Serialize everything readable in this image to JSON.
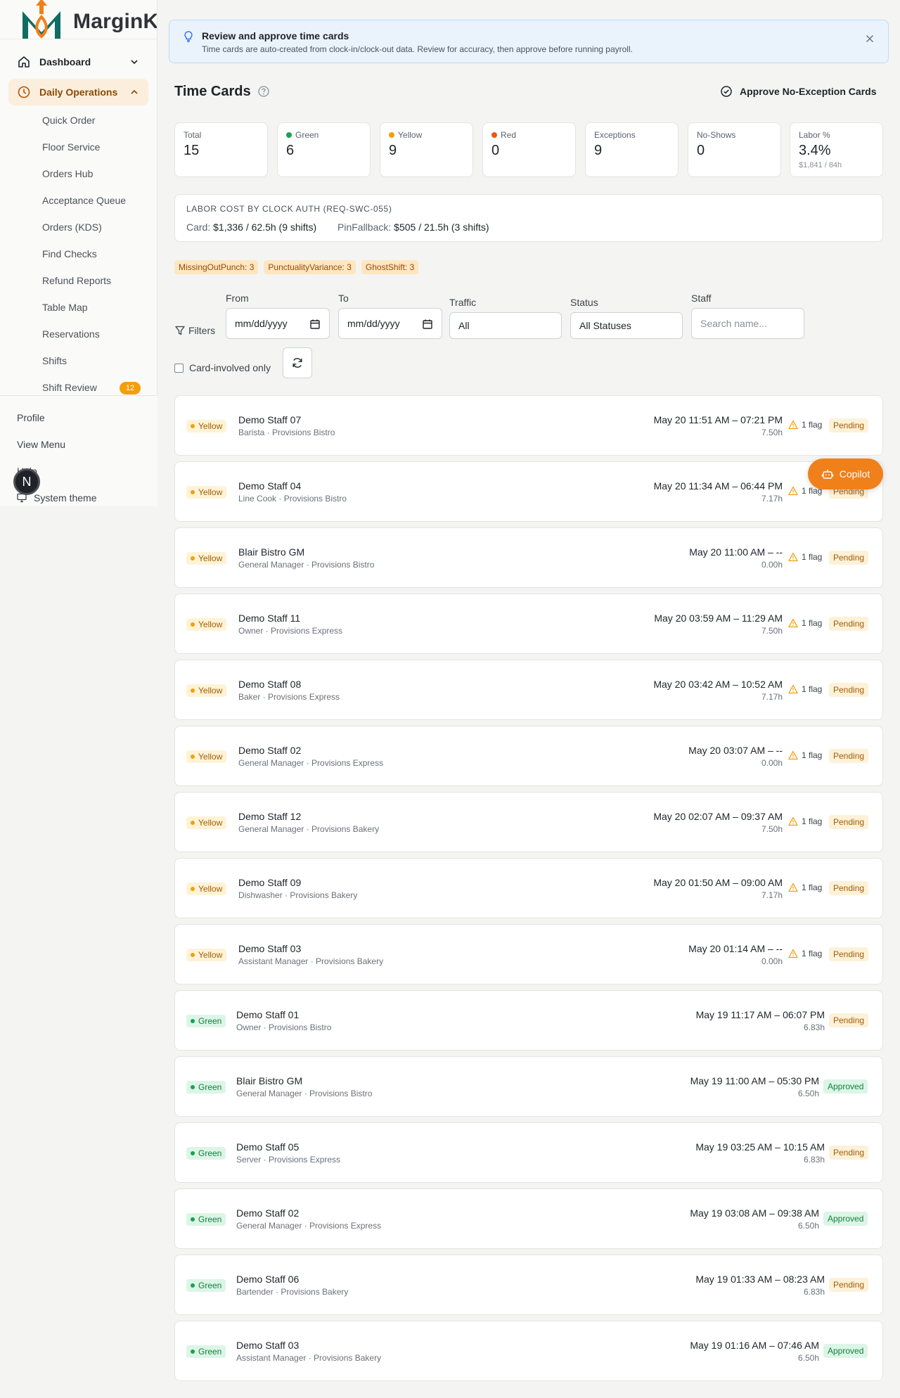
{
  "brand": {
    "name": "MarginK"
  },
  "sidebar": {
    "dashboard": "Dashboard",
    "daily_operations": "Daily Operations",
    "items": [
      "Quick Order",
      "Floor Service",
      "Orders Hub",
      "Acceptance Queue",
      "Orders (KDS)",
      "Find Checks",
      "Refund Reports",
      "Table Map",
      "Reservations",
      "Shifts",
      "Shift Review"
    ],
    "shift_review_count": "12",
    "footer": {
      "profile": "Profile",
      "view_menu": "View Menu",
      "help": "Help",
      "theme": "System theme"
    },
    "avatar_initial": "N"
  },
  "banner": {
    "title": "Review and approve time cards",
    "description": "Time cards are auto-created from clock-in/clock-out data. Review for accuracy, then approve before running payroll."
  },
  "page": {
    "title": "Time Cards",
    "approve_button": "Approve No-Exception Cards"
  },
  "stats": [
    {
      "label": "Total",
      "value": "15",
      "dot": ""
    },
    {
      "label": "Green",
      "value": "6",
      "dot": "#16a34a"
    },
    {
      "label": "Yellow",
      "value": "9",
      "dot": "#f59e0b"
    },
    {
      "label": "Red",
      "value": "0",
      "dot": "#ea580c"
    },
    {
      "label": "Exceptions",
      "value": "9",
      "dot": ""
    },
    {
      "label": "No-Shows",
      "value": "0",
      "dot": ""
    },
    {
      "label": "Labor %",
      "value": "3.4%",
      "dot": "",
      "sub": "$1,841 / 84h"
    }
  ],
  "labor": {
    "title": "LABOR COST BY CLOCK AUTH (REQ-SWC-055)",
    "card_label": "Card:",
    "card_value": "$1,336 / 62.5h (9 shifts)",
    "pin_label": "PinFallback:",
    "pin_value": "$505 / 21.5h (3 shifts)"
  },
  "chips": [
    "MissingOutPunch: 3",
    "PunctualityVariance: 3",
    "GhostShift: 3"
  ],
  "filters": {
    "toggle": "Filters",
    "from_label": "From",
    "from_value": "mm/dd/yyyy",
    "to_label": "To",
    "to_value": "mm/dd/yyyy",
    "traffic_label": "Traffic",
    "traffic_value": "All",
    "status_label": "Status",
    "status_value": "All Statuses",
    "staff_label": "Staff",
    "staff_placeholder": "Search name...",
    "card_only": "Card-involved only"
  },
  "cards": [
    {
      "traffic": "Yellow",
      "name": "Demo Staff 07",
      "role": "Barista · Provisions Bistro",
      "time": "May 20 11:51 AM – 07:21 PM",
      "hours": "7.50h",
      "flag": "1 flag",
      "status": "Pending"
    },
    {
      "traffic": "Yellow",
      "name": "Demo Staff 04",
      "role": "Line Cook · Provisions Bistro",
      "time": "May 20 11:34 AM – 06:44 PM",
      "hours": "7.17h",
      "flag": "1 flag",
      "status": "Pending"
    },
    {
      "traffic": "Yellow",
      "name": "Blair Bistro GM",
      "role": "General Manager · Provisions Bistro",
      "time": "May 20 11:00 AM – --",
      "hours": "0.00h",
      "flag": "1 flag",
      "status": "Pending"
    },
    {
      "traffic": "Yellow",
      "name": "Demo Staff 11",
      "role": "Owner · Provisions Express",
      "time": "May 20 03:59 AM – 11:29 AM",
      "hours": "7.50h",
      "flag": "1 flag",
      "status": "Pending"
    },
    {
      "traffic": "Yellow",
      "name": "Demo Staff 08",
      "role": "Baker · Provisions Express",
      "time": "May 20 03:42 AM – 10:52 AM",
      "hours": "7.17h",
      "flag": "1 flag",
      "status": "Pending"
    },
    {
      "traffic": "Yellow",
      "name": "Demo Staff 02",
      "role": "General Manager · Provisions Express",
      "time": "May 20 03:07 AM – --",
      "hours": "0.00h",
      "flag": "1 flag",
      "status": "Pending"
    },
    {
      "traffic": "Yellow",
      "name": "Demo Staff 12",
      "role": "General Manager · Provisions Bakery",
      "time": "May 20 02:07 AM – 09:37 AM",
      "hours": "7.50h",
      "flag": "1 flag",
      "status": "Pending"
    },
    {
      "traffic": "Yellow",
      "name": "Demo Staff 09",
      "role": "Dishwasher · Provisions Bakery",
      "time": "May 20 01:50 AM – 09:00 AM",
      "hours": "7.17h",
      "flag": "1 flag",
      "status": "Pending"
    },
    {
      "traffic": "Yellow",
      "name": "Demo Staff 03",
      "role": "Assistant Manager · Provisions Bakery",
      "time": "May 20 01:14 AM – --",
      "hours": "0.00h",
      "flag": "1 flag",
      "status": "Pending"
    },
    {
      "traffic": "Green",
      "name": "Demo Staff 01",
      "role": "Owner · Provisions Bistro",
      "time": "May 19 11:17 AM – 06:07 PM",
      "hours": "6.83h",
      "flag": "",
      "status": "Pending"
    },
    {
      "traffic": "Green",
      "name": "Blair Bistro GM",
      "role": "General Manager · Provisions Bistro",
      "time": "May 19 11:00 AM – 05:30 PM",
      "hours": "6.50h",
      "flag": "",
      "status": "Approved"
    },
    {
      "traffic": "Green",
      "name": "Demo Staff 05",
      "role": "Server · Provisions Express",
      "time": "May 19 03:25 AM – 10:15 AM",
      "hours": "6.83h",
      "flag": "",
      "status": "Pending"
    },
    {
      "traffic": "Green",
      "name": "Demo Staff 02",
      "role": "General Manager · Provisions Express",
      "time": "May 19 03:08 AM – 09:38 AM",
      "hours": "6.50h",
      "flag": "",
      "status": "Approved"
    },
    {
      "traffic": "Green",
      "name": "Demo Staff 06",
      "role": "Bartender · Provisions Bakery",
      "time": "May 19 01:33 AM – 08:23 AM",
      "hours": "6.83h",
      "flag": "",
      "status": "Pending"
    },
    {
      "traffic": "Green",
      "name": "Demo Staff 03",
      "role": "Assistant Manager · Provisions Bakery",
      "time": "May 19 01:16 AM – 07:46 AM",
      "hours": "6.50h",
      "flag": "",
      "status": "Approved"
    }
  ],
  "copilot": "Copilot",
  "colors": {
    "accent": "#f0801a",
    "brand_teal": "#0f6b63",
    "banner_bg": "#eaf3fc"
  },
  "icons": [
    "home-icon",
    "clock-icon",
    "chevron-down-icon",
    "chevron-up-icon",
    "lightbulb-icon",
    "close-icon",
    "help-circle-icon",
    "check-circle-icon",
    "filter-icon",
    "calendar-icon",
    "refresh-icon",
    "warning-icon",
    "monitor-icon",
    "bot-icon"
  ]
}
